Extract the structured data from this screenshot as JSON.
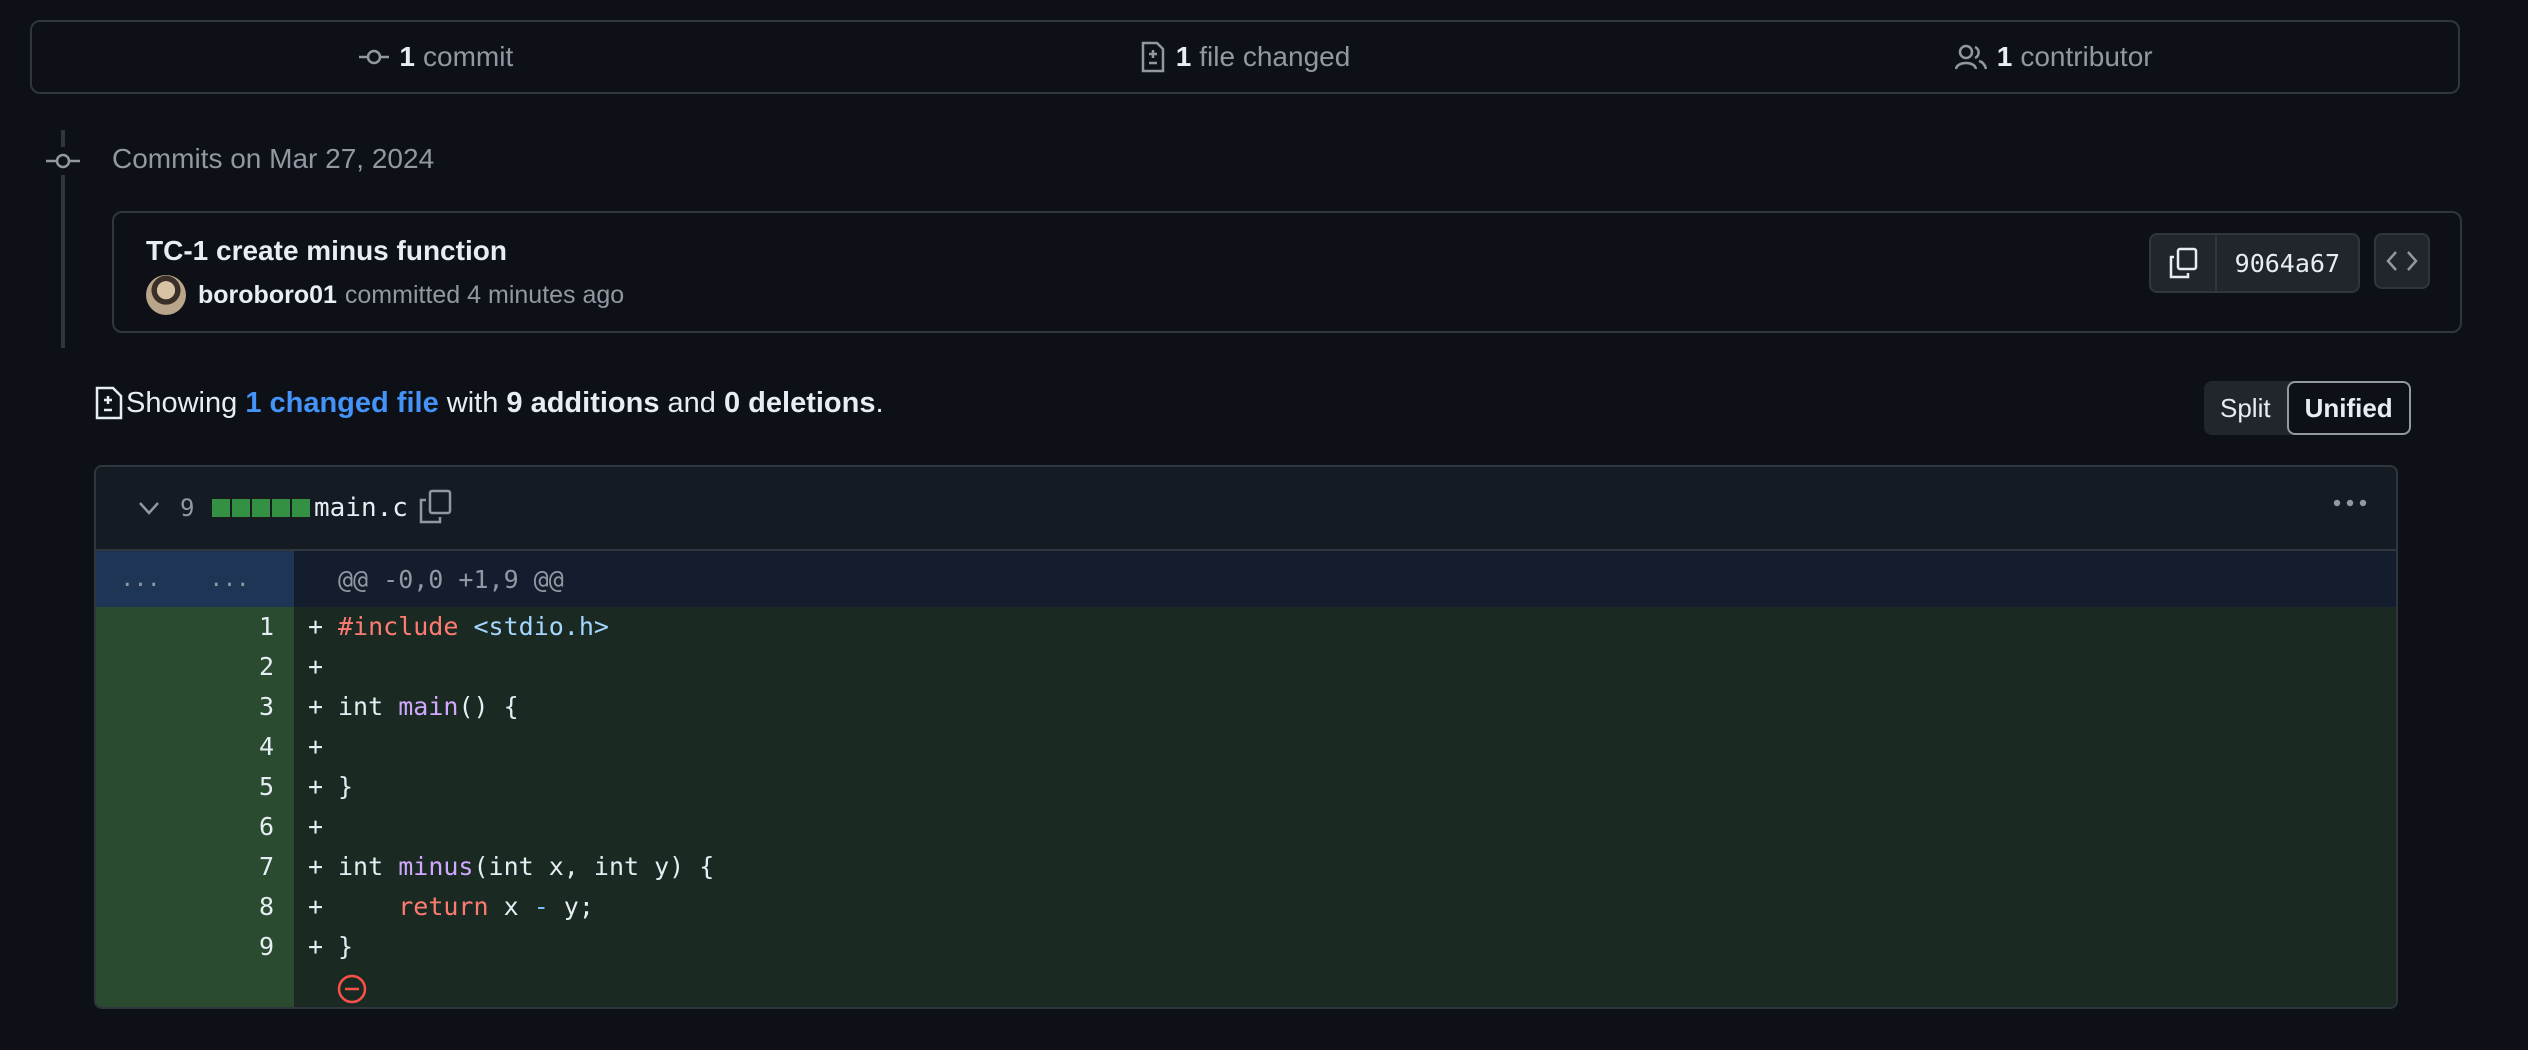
{
  "stats": {
    "commits_count": "1",
    "commits_label": "commit",
    "files_count": "1",
    "files_label": "file changed",
    "contributors_count": "1",
    "contributors_label": "contributor"
  },
  "commits": {
    "date_label": "Commits on Mar 27, 2024",
    "items": [
      {
        "title": "TC-1 create minus function",
        "author": "boroboro01",
        "action": "committed",
        "time": "4 minutes ago",
        "sha": "9064a67"
      }
    ]
  },
  "summary": {
    "prefix": "Showing",
    "changed_link": "1 changed file",
    "with": "with",
    "additions": "9 additions",
    "and": "and",
    "deletions": "0 deletions",
    "suffix": "."
  },
  "view_toggle": {
    "split": "Split",
    "unified": "Unified",
    "active": "unified"
  },
  "file": {
    "change_count": "9",
    "name": "main.c",
    "hunk_left": "...",
    "hunk_right": "...",
    "hunk_header": "@@ -0,0 +1,9 @@",
    "lines": [
      {
        "num": "1",
        "sign": "+"
      },
      {
        "num": "2",
        "sign": "+"
      },
      {
        "num": "3",
        "sign": "+"
      },
      {
        "num": "4",
        "sign": "+"
      },
      {
        "num": "5",
        "sign": "+"
      },
      {
        "num": "6",
        "sign": "+"
      },
      {
        "num": "7",
        "sign": "+"
      },
      {
        "num": "8",
        "sign": "+"
      },
      {
        "num": "9",
        "sign": "+"
      }
    ],
    "code": {
      "l1_kw": "#include",
      "l1_str": "<stdio.h>",
      "l3_type": "int",
      "l3_fn": "main",
      "l3_rest": "() {",
      "l5": "}",
      "l7_type": "int",
      "l7_fn": "minus",
      "l7_rest": "(int x, int y) {",
      "l8_indent": "    ",
      "l8_kw": "return",
      "l8_a": " x ",
      "l8_op": "-",
      "l8_b": " y;",
      "l9": "}"
    }
  },
  "colors": {
    "background": "#0d1117",
    "accent_link": "#4493f8",
    "addition_green": "#3fb950",
    "deletion_red": "#f85149"
  },
  "icons": [
    "git-commit-icon",
    "file-diff-icon",
    "people-icon",
    "copy-icon",
    "code-icon",
    "chevron-down-icon",
    "kebab-horizontal-icon",
    "no-newline-icon"
  ]
}
